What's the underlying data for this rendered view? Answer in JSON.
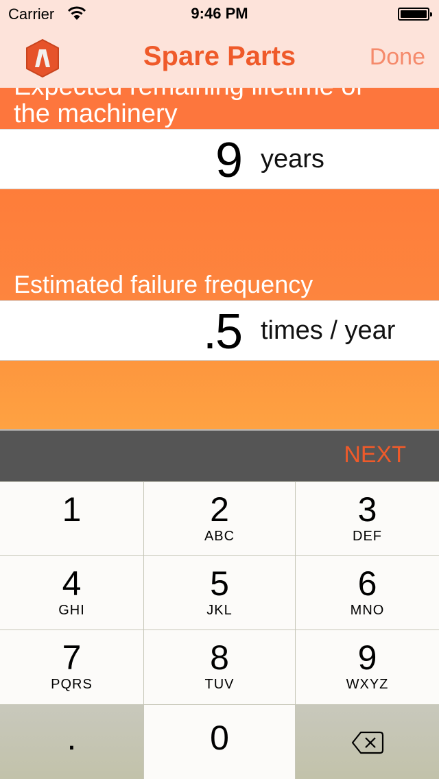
{
  "status_bar": {
    "carrier": "Carrier",
    "time": "9:46 PM",
    "icons": [
      "wifi-icon",
      "battery-icon"
    ]
  },
  "nav": {
    "title": "Spare Parts",
    "done_label": "Done",
    "logo_icon": "app-logo-icon"
  },
  "form": {
    "field1": {
      "label_line1": "Expected remaining lifetime of",
      "label_line2": "the machinery",
      "value": "9",
      "unit": "years"
    },
    "field2": {
      "label": "Estimated failure frequency",
      "value": ".5",
      "unit": "times / year"
    }
  },
  "toolbar": {
    "next_label": "NEXT"
  },
  "keypad": {
    "keys": [
      {
        "digit": "1",
        "letters": ""
      },
      {
        "digit": "2",
        "letters": "ABC"
      },
      {
        "digit": "3",
        "letters": "DEF"
      },
      {
        "digit": "4",
        "letters": "GHI"
      },
      {
        "digit": "5",
        "letters": "JKL"
      },
      {
        "digit": "6",
        "letters": "MNO"
      },
      {
        "digit": "7",
        "letters": "PQRS"
      },
      {
        "digit": "8",
        "letters": "TUV"
      },
      {
        "digit": "9",
        "letters": "WXYZ"
      },
      {
        "digit": ".",
        "letters": ""
      },
      {
        "digit": "0",
        "letters": ""
      }
    ],
    "backspace_icon": "backspace-icon"
  },
  "colors": {
    "accent": "#ef5a2a",
    "nav_background": "#fde3da",
    "band_orange": "#fd763d",
    "toolbar_gray": "#555555"
  }
}
